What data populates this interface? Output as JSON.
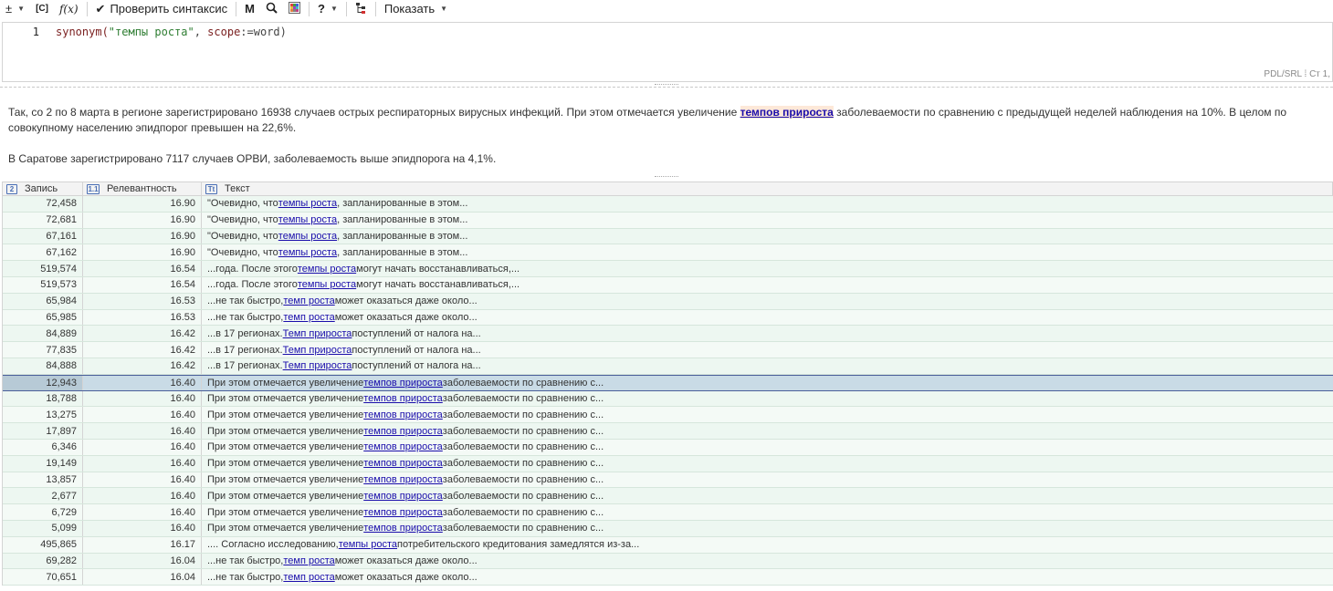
{
  "toolbar": {
    "plusminus": "±",
    "case_label": "[C]",
    "func_label": "f(x)",
    "check_syntax_label": "Проверить синтаксис",
    "m_label": "M",
    "help_label": "?",
    "show_label": "Показать"
  },
  "editor": {
    "line_number": "1",
    "code_fn": "synonym(",
    "code_str": "\"темпы роста\"",
    "code_sep": ", ",
    "code_kw": "scope",
    "code_op": ":=word)",
    "status": "PDL/SRL ⁞ Ст 1,"
  },
  "preview": {
    "p1_before": "Так, со 2 по 8 марта в регионе зарегистрировано 16938 случаев острых респираторных вирусных инфекций. При этом отмечается увеличение ",
    "p1_highlight": "темпов прироста",
    "p1_after": " заболеваемости по сравнению с предыдущей неделей наблюдения на 10%. В целом по совокупному населению эпидпорог превышен на 22,6%.",
    "p2": "В Саратове зарегистрировано 7117 случаев ОРВИ, заболеваемость выше эпидпорога на 4,1%."
  },
  "grid": {
    "columns": [
      {
        "icon": "2",
        "label": "Запись"
      },
      {
        "icon": "1.1",
        "label": "Релевантность"
      },
      {
        "icon": "Tt",
        "label": "Текст"
      }
    ],
    "rows": [
      {
        "record": "72,458",
        "rel": "16.90",
        "pre": "\"Очевидно, что ",
        "link": "темпы роста",
        "post": ", запланированные в этом..."
      },
      {
        "record": "72,681",
        "rel": "16.90",
        "pre": "\"Очевидно, что ",
        "link": "темпы роста",
        "post": ", запланированные в этом..."
      },
      {
        "record": "67,161",
        "rel": "16.90",
        "pre": "\"Очевидно, что ",
        "link": "темпы роста",
        "post": ", запланированные в этом..."
      },
      {
        "record": "67,162",
        "rel": "16.90",
        "pre": "\"Очевидно, что ",
        "link": "темпы роста",
        "post": ", запланированные в этом..."
      },
      {
        "record": "519,574",
        "rel": "16.54",
        "pre": "...года. После этого ",
        "link": "темпы роста",
        "post": " могут начать восстанавливаться,..."
      },
      {
        "record": "519,573",
        "rel": "16.54",
        "pre": "...года. После этого ",
        "link": "темпы роста",
        "post": " могут начать восстанавливаться,..."
      },
      {
        "record": "65,984",
        "rel": "16.53",
        "pre": "...не так быстро, ",
        "link": "темп роста",
        "post": " может оказаться даже около..."
      },
      {
        "record": "65,985",
        "rel": "16.53",
        "pre": "...не так быстро, ",
        "link": "темп роста",
        "post": " может оказаться даже около..."
      },
      {
        "record": "84,889",
        "rel": "16.42",
        "pre": "...в 17 регионах. ",
        "link": "Темп прироста",
        "post": " поступлений от налога на..."
      },
      {
        "record": "77,835",
        "rel": "16.42",
        "pre": "...в 17 регионах. ",
        "link": "Темп прироста",
        "post": " поступлений от налога на..."
      },
      {
        "record": "84,888",
        "rel": "16.42",
        "pre": "...в 17 регионах. ",
        "link": "Темп прироста",
        "post": " поступлений от налога на..."
      },
      {
        "record": "12,943",
        "rel": "16.40",
        "pre": "При этом отмечается увеличение ",
        "link": "темпов прироста",
        "post": " заболеваемости по сравнению с...",
        "selected": true
      },
      {
        "record": "18,788",
        "rel": "16.40",
        "pre": "При этом отмечается увеличение ",
        "link": "темпов прироста",
        "post": " заболеваемости по сравнению с..."
      },
      {
        "record": "13,275",
        "rel": "16.40",
        "pre": "При этом отмечается увеличение ",
        "link": "темпов прироста",
        "post": " заболеваемости по сравнению с..."
      },
      {
        "record": "17,897",
        "rel": "16.40",
        "pre": "При этом отмечается увеличение ",
        "link": "темпов прироста",
        "post": " заболеваемости по сравнению с..."
      },
      {
        "record": "6,346",
        "rel": "16.40",
        "pre": "При этом отмечается увеличение ",
        "link": "темпов прироста",
        "post": " заболеваемости по сравнению с..."
      },
      {
        "record": "19,149",
        "rel": "16.40",
        "pre": "При этом отмечается увеличение ",
        "link": "темпов прироста",
        "post": " заболеваемости по сравнению с..."
      },
      {
        "record": "13,857",
        "rel": "16.40",
        "pre": "При этом отмечается увеличение ",
        "link": "темпов прироста",
        "post": " заболеваемости по сравнению с..."
      },
      {
        "record": "2,677",
        "rel": "16.40",
        "pre": "При этом отмечается увеличение ",
        "link": "темпов прироста",
        "post": " заболеваемости по сравнению с..."
      },
      {
        "record": "6,729",
        "rel": "16.40",
        "pre": "При этом отмечается увеличение ",
        "link": "темпов прироста",
        "post": " заболеваемости по сравнению с..."
      },
      {
        "record": "5,099",
        "rel": "16.40",
        "pre": "При этом отмечается увеличение ",
        "link": "темпов прироста",
        "post": " заболеваемости по сравнению с..."
      },
      {
        "record": "495,865",
        "rel": "16.17",
        "pre": ".... Согласно исследованию, ",
        "link": "темпы роста",
        "post": " потребительского кредитования замедлятся из-за..."
      },
      {
        "record": "69,282",
        "rel": "16.04",
        "pre": "...не так быстро, ",
        "link": "темп роста",
        "post": " может оказаться даже около..."
      },
      {
        "record": "70,651",
        "rel": "16.04",
        "pre": "...не так быстро, ",
        "link": "темп роста",
        "post": " может оказаться даже около..."
      }
    ]
  }
}
